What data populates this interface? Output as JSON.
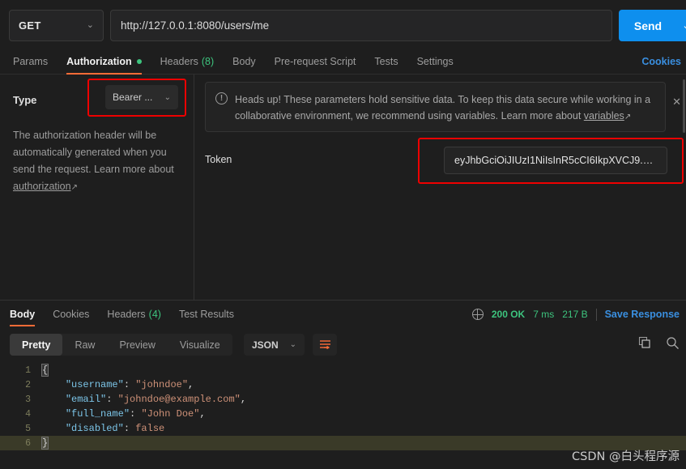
{
  "request_bar": {
    "method": "GET",
    "method_caret": "chevron-down",
    "url": "http://127.0.0.1:8080/users/me",
    "send_label": "Send",
    "send_caret": "chevron-down"
  },
  "request_tabs": {
    "items": [
      {
        "label": "Params",
        "active": false,
        "dot": false,
        "count": ""
      },
      {
        "label": "Authorization",
        "active": true,
        "dot": true,
        "count": ""
      },
      {
        "label": "Headers",
        "active": false,
        "dot": false,
        "count": "(8)"
      },
      {
        "label": "Body",
        "active": false,
        "dot": false,
        "count": ""
      },
      {
        "label": "Pre-request Script",
        "active": false,
        "dot": false,
        "count": ""
      },
      {
        "label": "Tests",
        "active": false,
        "dot": false,
        "count": ""
      },
      {
        "label": "Settings",
        "active": false,
        "dot": false,
        "count": ""
      }
    ],
    "cookies_link": "Cookies"
  },
  "auth": {
    "type_label": "Type",
    "type_value": "Bearer ...",
    "type_caret": "chevron-down",
    "description": "The authorization header will be automatically generated when you send the request. Learn more about ",
    "description_link": "authorization",
    "description_link_arrow": "↗",
    "banner": {
      "icon": "info-exclamation-icon",
      "text": "Heads up! These parameters hold sensitive data. To keep this data secure while working in a collaborative environment, we recommend using variables. Learn more about ",
      "link": "variables",
      "link_arrow": "↗",
      "close": "✕"
    },
    "token_label": "Token",
    "token_value": "eyJhbGciOiJIUzI1NiIsInR5cCI6IkpXVCJ9.ey. ..."
  },
  "response": {
    "tabs": [
      {
        "label": "Body",
        "active": true,
        "count": ""
      },
      {
        "label": "Cookies",
        "active": false,
        "count": ""
      },
      {
        "label": "Headers",
        "active": false,
        "count": "(4)"
      },
      {
        "label": "Test Results",
        "active": false,
        "count": ""
      }
    ],
    "status_code": "200 OK",
    "time": "7 ms",
    "size": "217 B",
    "save_label": "Save Response",
    "view_modes": [
      {
        "label": "Pretty",
        "active": true
      },
      {
        "label": "Raw",
        "active": false
      },
      {
        "label": "Preview",
        "active": false
      },
      {
        "label": "Visualize",
        "active": false
      }
    ],
    "format": "JSON",
    "format_caret": "chevron-down",
    "wrap_icon": "wrap-text-icon",
    "copy_icon": "copy-icon",
    "search_icon": "search-icon",
    "body_lines": [
      {
        "n": "1",
        "segments": [
          {
            "t": "{",
            "c": "brace-hl"
          }
        ]
      },
      {
        "n": "2",
        "segments": [
          {
            "t": "    ",
            "c": "tok-punct"
          },
          {
            "t": "\"username\"",
            "c": "tok-key"
          },
          {
            "t": ": ",
            "c": "tok-punct"
          },
          {
            "t": "\"johndoe\"",
            "c": "tok-str"
          },
          {
            "t": ",",
            "c": "tok-punct"
          }
        ]
      },
      {
        "n": "3",
        "segments": [
          {
            "t": "    ",
            "c": "tok-punct"
          },
          {
            "t": "\"email\"",
            "c": "tok-key"
          },
          {
            "t": ": ",
            "c": "tok-punct"
          },
          {
            "t": "\"johndoe@example.com\"",
            "c": "tok-str"
          },
          {
            "t": ",",
            "c": "tok-punct"
          }
        ]
      },
      {
        "n": "4",
        "segments": [
          {
            "t": "    ",
            "c": "tok-punct"
          },
          {
            "t": "\"full_name\"",
            "c": "tok-key"
          },
          {
            "t": ": ",
            "c": "tok-punct"
          },
          {
            "t": "\"John Doe\"",
            "c": "tok-str"
          },
          {
            "t": ",",
            "c": "tok-punct"
          }
        ]
      },
      {
        "n": "5",
        "segments": [
          {
            "t": "    ",
            "c": "tok-punct"
          },
          {
            "t": "\"disabled\"",
            "c": "tok-key"
          },
          {
            "t": ": ",
            "c": "tok-punct"
          },
          {
            "t": "false",
            "c": "tok-bool"
          }
        ]
      },
      {
        "n": "6",
        "segments": [
          {
            "t": "}",
            "c": "brace-hl"
          }
        ],
        "cursor": true
      }
    ]
  },
  "watermark": "CSDN @白头程序源",
  "colors": {
    "accent_orange": "#ff6c37",
    "send_blue": "#0e8fee",
    "link_blue": "#3a8fe0",
    "status_green": "#3dc47e",
    "highlight_red": "#ee0000",
    "bg": "#1e1e1e"
  }
}
